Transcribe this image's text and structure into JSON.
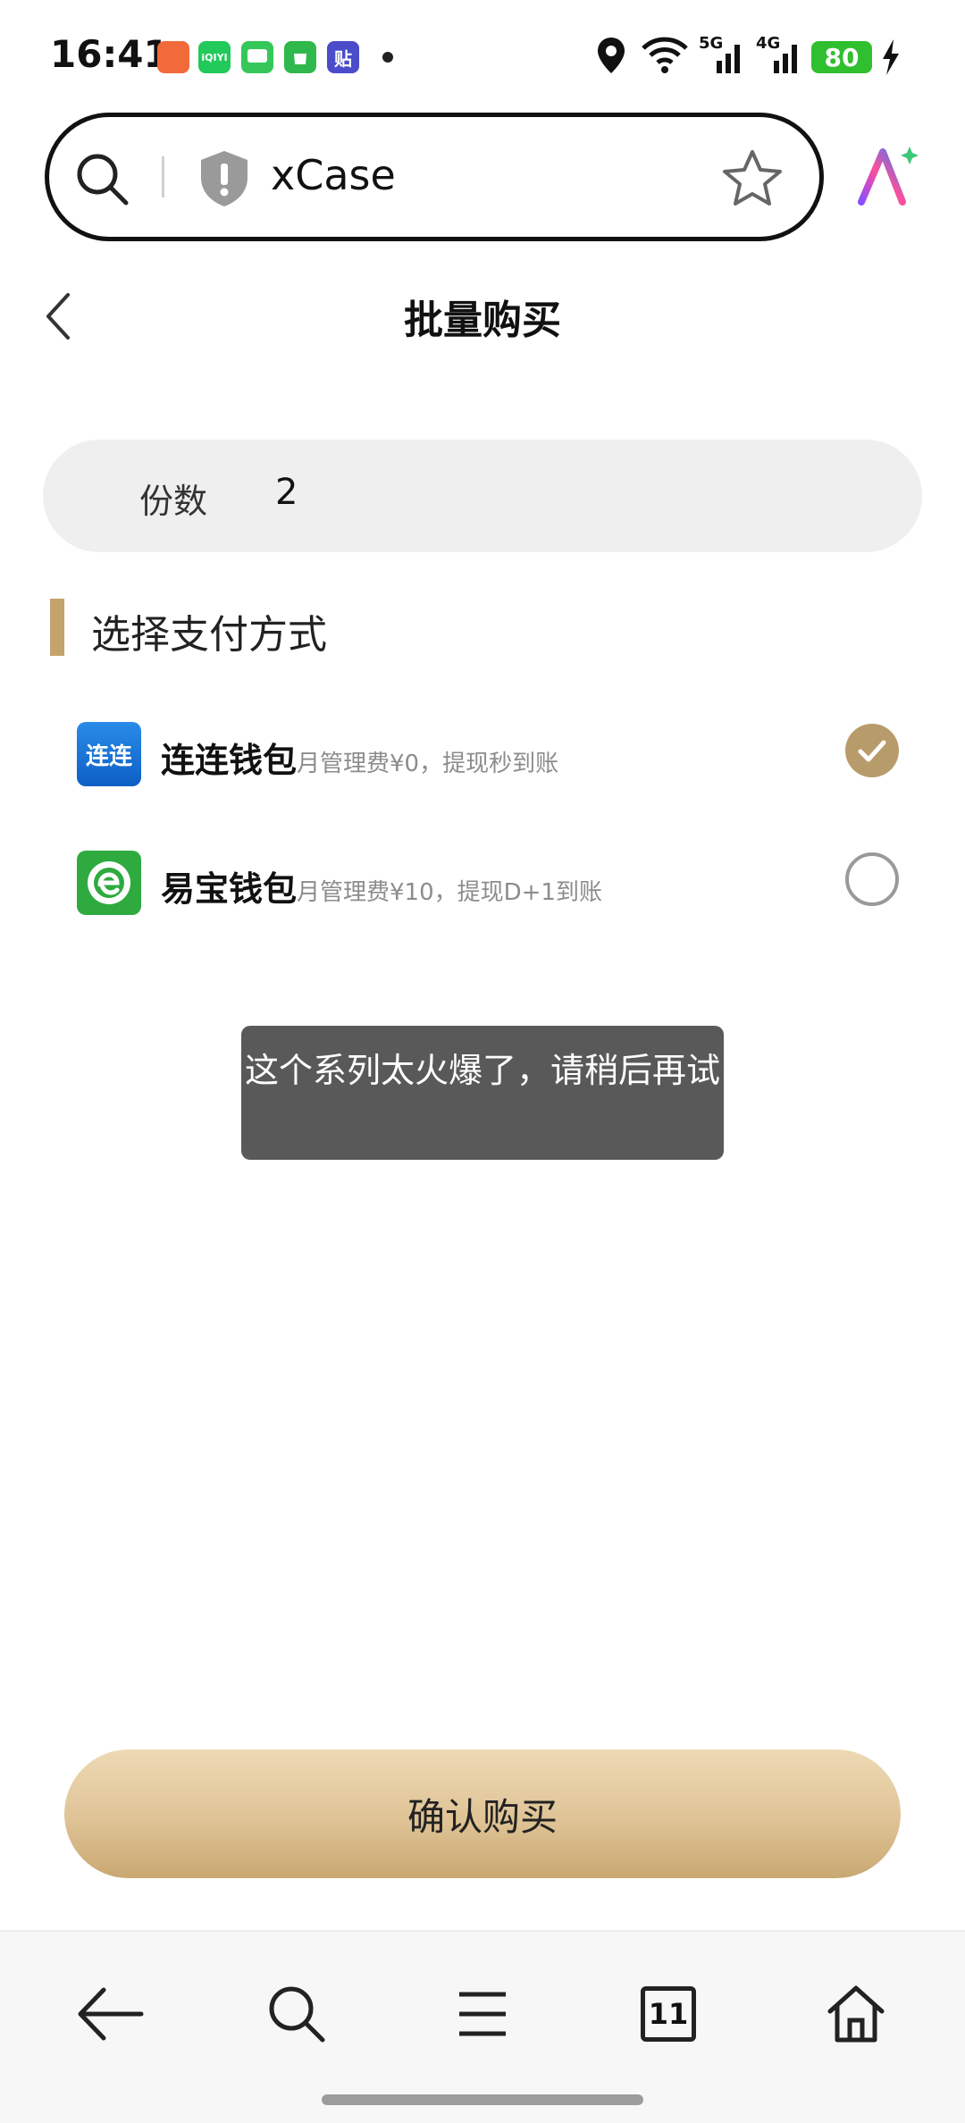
{
  "status_bar": {
    "time": "16:41",
    "notifications": [
      {
        "name": "game-app-icon",
        "color": "#f26a3a",
        "text": ""
      },
      {
        "name": "iqiyi-app-icon",
        "color": "#22c95b",
        "text": "iQIYI"
      },
      {
        "name": "message-app-icon",
        "color": "#35c759",
        "text": ""
      },
      {
        "name": "store-app-icon",
        "color": "#2fb84b",
        "text": ""
      },
      {
        "name": "tieba-app-icon",
        "color": "#4a4cc9",
        "text": "贴"
      }
    ],
    "battery": "80",
    "network_5g": "5G",
    "network_4g": "4G"
  },
  "address_bar": {
    "url": "xCase"
  },
  "header": {
    "title": "批量购买"
  },
  "quantity": {
    "label": "份数",
    "value": "2"
  },
  "payment": {
    "section_title": "选择支付方式",
    "methods": [
      {
        "name": "连连钱包",
        "desc": "月管理费¥0，提现秒到账",
        "icon_text": "连连",
        "selected": true
      },
      {
        "name": "易宝钱包",
        "desc": "月管理费¥10，提现D+1到账",
        "icon_text": "",
        "selected": false
      }
    ]
  },
  "toast": {
    "message": "这个系列太火爆了，请稍后再试"
  },
  "confirm_button": {
    "label": "确认购买"
  },
  "bottom_nav": {
    "tab_count": "11"
  },
  "colors": {
    "accent": "#c4a46c",
    "selected_radio": "#b89b6a",
    "lianlian_blue": "#1a73d9",
    "yibao_green": "#2eaa3f"
  }
}
